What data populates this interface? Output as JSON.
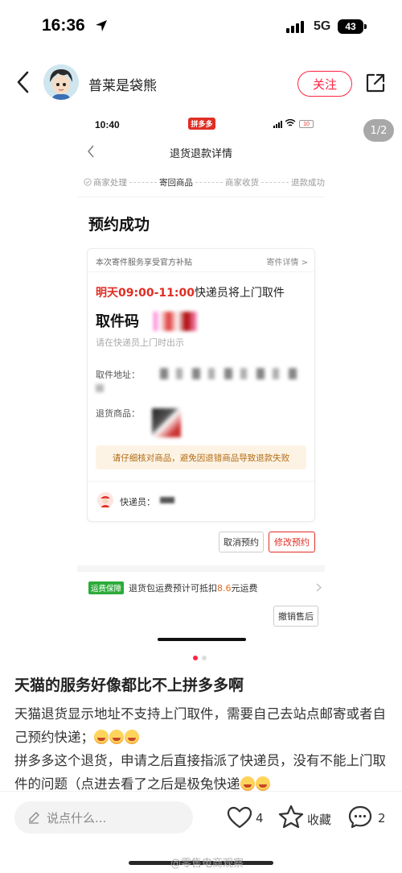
{
  "status_bar": {
    "time": "16:36",
    "network": "5G",
    "battery": "43"
  },
  "header": {
    "author": "普莱是袋熊",
    "follow_label": "关注"
  },
  "image_indicator": "1/2",
  "screenshot": {
    "status_time": "10:40",
    "app_badge": "拼多多",
    "battery": "10",
    "title": "退货退款详情",
    "steps": [
      "商家处理",
      "寄回商品",
      "商家收货",
      "退款成功"
    ],
    "heading": "预约成功",
    "card": {
      "subsidy_note": "本次寄件服务享受官方补贴",
      "detail_link": "寄件详情 >",
      "pickup_time_red": "明天09:00-11:00",
      "pickup_time_rest": "快递员将上门取件",
      "pickup_code_label": "取件码",
      "pickup_hint": "请在快递员上门时出示",
      "address_label": "取件地址：",
      "goods_label": "退货商品：",
      "warning": "请仔细核对商品，避免因退错商品导致退款失败",
      "courier_label": "快递员："
    },
    "cancel_label": "取消预约",
    "modify_label": "修改预约",
    "shipping": {
      "badge": "运费保障",
      "text_before": "退货包运费预计可抵扣",
      "amount": "8.6",
      "text_after": "元运费"
    },
    "undo_label": "撤销售后"
  },
  "post": {
    "title": "天猫的服务好像都比不上拼多多啊",
    "para1": "天猫退货显示地址不支持上门取件，需要自己去站点邮寄或者自己预约快递；",
    "para2": "拼多多这个退货，申请之后直接指派了快递员，没有不能上门取件的问题（点进去看了之后是极兔快递"
  },
  "bottom_bar": {
    "comment_placeholder": "说点什么...",
    "likes": "4",
    "favorite_label": "收藏",
    "comments": "2",
    "watermark": "@零售电商观察"
  },
  "colors": {
    "accent": "#ff2442",
    "pdd_red": "#e02e24",
    "ship_green": "#2dab3b"
  }
}
